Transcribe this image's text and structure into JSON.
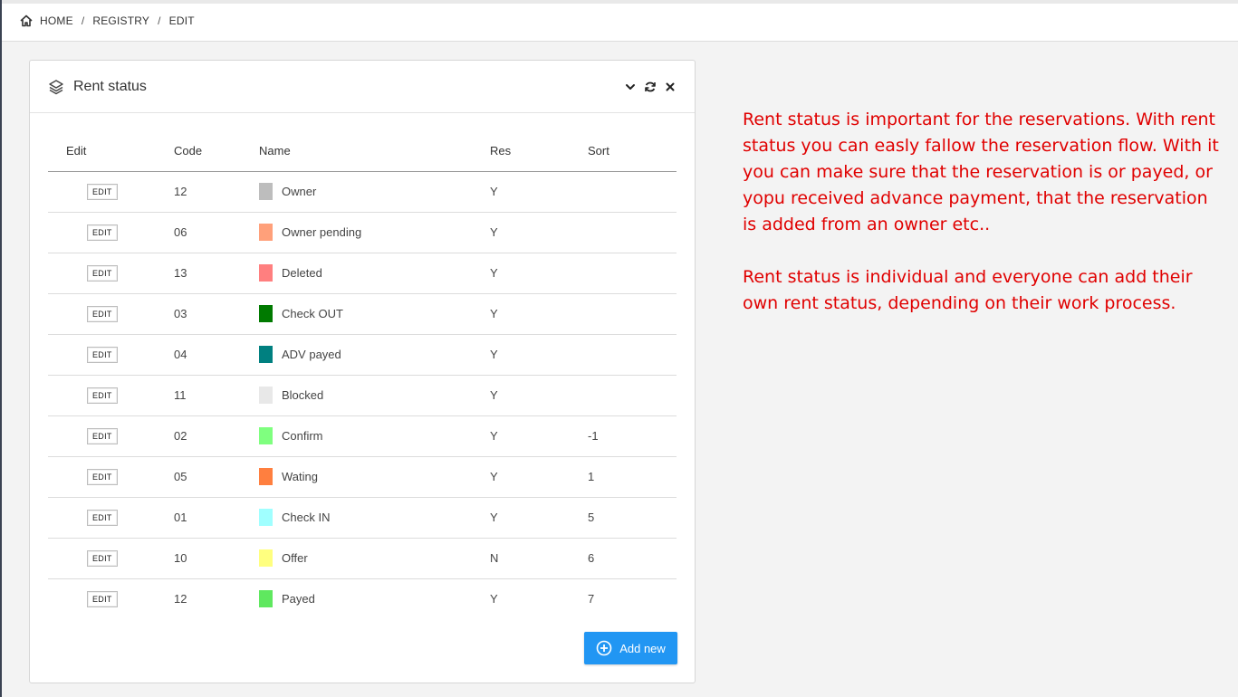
{
  "breadcrumb": {
    "items": [
      "HOME",
      "REGISTRY",
      "EDIT"
    ],
    "separator": "/"
  },
  "panel": {
    "title": "Rent status",
    "icons": [
      "layers-icon",
      "chevron-down-icon",
      "refresh-icon",
      "close-icon"
    ]
  },
  "table": {
    "headers": [
      "Edit",
      "Code",
      "Name",
      "Res",
      "Sort"
    ],
    "edit_label": "EDIT",
    "rows": [
      {
        "code": "12",
        "name": "Owner",
        "color": "#bdbdbd",
        "res": "Y",
        "sort": ""
      },
      {
        "code": "06",
        "name": "Owner pending",
        "color": "#ffa07a",
        "res": "Y",
        "sort": ""
      },
      {
        "code": "13",
        "name": "Deleted",
        "color": "#ff7f7f",
        "res": "Y",
        "sort": ""
      },
      {
        "code": "03",
        "name": "Check OUT",
        "color": "#007a00",
        "res": "Y",
        "sort": ""
      },
      {
        "code": "04",
        "name": "ADV payed",
        "color": "#008080",
        "res": "Y",
        "sort": ""
      },
      {
        "code": "11",
        "name": "Blocked",
        "color": "#e8e8e8",
        "res": "Y",
        "sort": ""
      },
      {
        "code": "02",
        "name": "Confirm",
        "color": "#7fff7f",
        "res": "Y",
        "sort": "-1"
      },
      {
        "code": "05",
        "name": "Wating",
        "color": "#ff7f3f",
        "res": "Y",
        "sort": "1"
      },
      {
        "code": "01",
        "name": "Check IN",
        "color": "#a0ffff",
        "res": "Y",
        "sort": "5"
      },
      {
        "code": "10",
        "name": "Offer",
        "color": "#ffff7f",
        "res": "N",
        "sort": "6"
      },
      {
        "code": "12",
        "name": "Payed",
        "color": "#5fe85f",
        "res": "Y",
        "sort": "7"
      }
    ]
  },
  "add_button": {
    "label": "Add new",
    "color": "#2196f3"
  },
  "note": {
    "color": "#e00000",
    "paragraphs": [
      "Rent status is important for the reservations. With rent status you can easly fallow the reservation flow. With it you can make sure that the reservation is or payed, or yopu received advance payment, that the reservation is added from an owner etc..",
      "Rent status is individual and everyone can add their own rent status, depending on their work process."
    ]
  }
}
